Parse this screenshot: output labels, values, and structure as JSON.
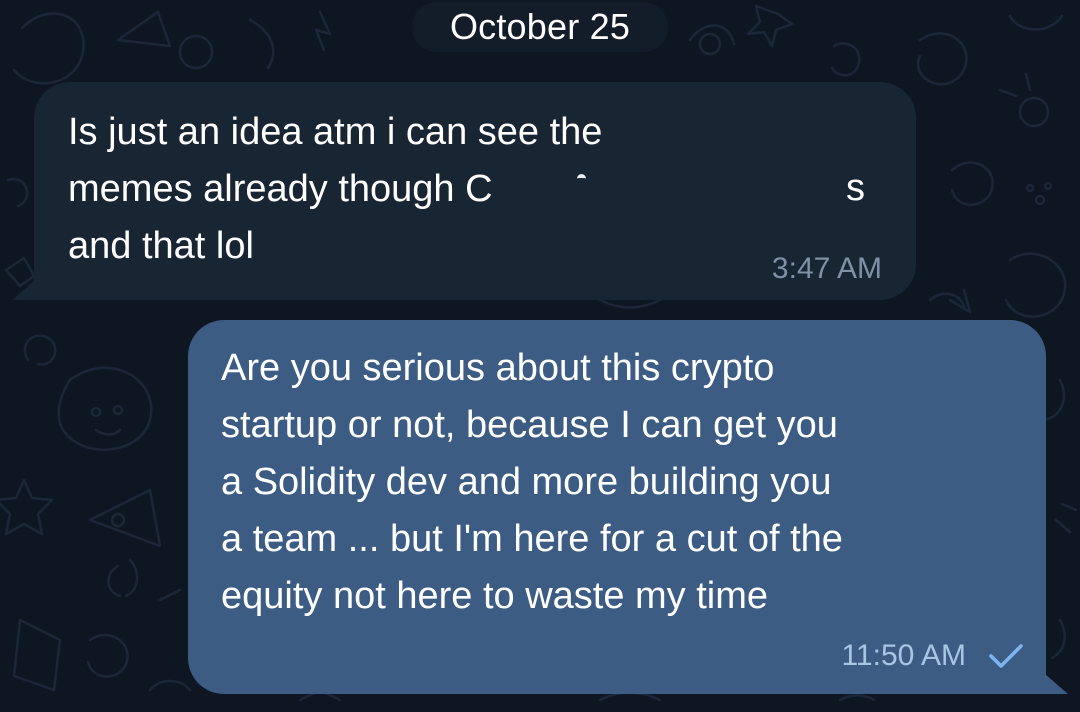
{
  "date_separator": "October 25",
  "messages": [
    {
      "direction": "incoming",
      "text": "Is just an idea atm i can see the\nmemes already though C\nand that lol",
      "time": "3:47 AM"
    },
    {
      "direction": "outgoing",
      "text": "Are you serious about this crypto\nstartup or not, because I can get you\na Solidity dev and more building you\na team ... but I'm here for a cut of the\nequity not here to waste my time",
      "time": "11:50 AM",
      "status_icon": "single-check-icon"
    }
  ],
  "colors": {
    "background": "#0e1621",
    "incoming_bubble": "#182533",
    "outgoing_bubble": "#3c5c84",
    "incoming_time": "#7f91a4",
    "outgoing_time": "#a9c5e4",
    "check": "#7fb5ef"
  }
}
